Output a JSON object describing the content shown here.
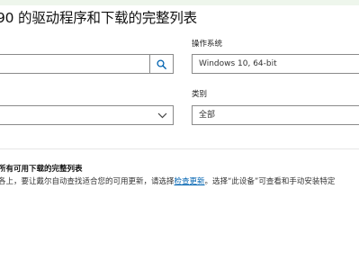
{
  "header": {
    "title": "90 的驱动程序和下载的完整列表"
  },
  "filters": {
    "search_input_value": "",
    "os_label": "操作系统",
    "os_value": "Windows 10, 64-bit",
    "category_label": "类别",
    "category_value": "全部",
    "keyword_value": ""
  },
  "icons": {
    "search": "search-icon",
    "dropdown": "chevron-down-icon"
  },
  "downloads_section": {
    "title": "所有可用下载的完整列表",
    "desc_before_link": "各上，要让戴尔自动查找适合您的可用更新，请选择",
    "link_text": "检查更新",
    "desc_after_link": "。选择“此设备”可查看和手动安装特定"
  },
  "colors": {
    "link": "#0063b1",
    "border": "#8a8a8a",
    "top_band": "#eef6ec"
  }
}
